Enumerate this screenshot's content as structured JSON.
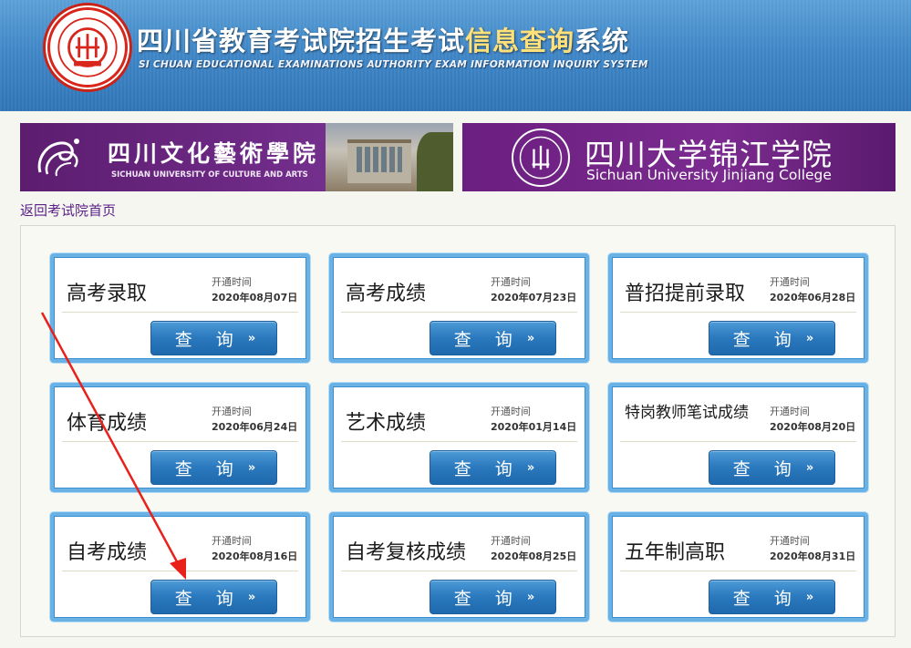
{
  "header": {
    "title_part1": "四川省教育考试院招生考试",
    "title_highlight": "信息查询",
    "title_part2": "系统",
    "subtitle": "SI CHUAN EDUCATIONAL EXAMINATIONS AUTHORITY EXAM INFORMATION INQUIRY SYSTEM",
    "brand_color": "#3f86c6",
    "highlight_color": "#ffe079"
  },
  "banners": {
    "left": {
      "name_cn": "四川文化藝術學院",
      "name_en": "SICHUAN UNIVERSITY OF CULTURE AND ARTS"
    },
    "right": {
      "name_cn": "四川大学锦江学院",
      "name_en": "Sichuan University Jinjiang College"
    }
  },
  "back_link": "返回考试院首页",
  "open_label": "开通时间",
  "query_label": "查 询",
  "query_chevron": "»",
  "cards": [
    {
      "name": "高考录取",
      "date": "2020年08月07日"
    },
    {
      "name": "高考成绩",
      "date": "2020年07月23日"
    },
    {
      "name": "普招提前录取",
      "date": "2020年06月28日"
    },
    {
      "name": "体育成绩",
      "date": "2020年06月24日"
    },
    {
      "name": "艺术成绩",
      "date": "2020年01月14日"
    },
    {
      "name": "特岗教师笔试成绩",
      "date": "2020年08月20日"
    },
    {
      "name": "自考成绩",
      "date": "2020年08月16日"
    },
    {
      "name": "自考复核成绩",
      "date": "2020年08月25日"
    },
    {
      "name": "五年制高职",
      "date": "2020年08月31日"
    }
  ]
}
